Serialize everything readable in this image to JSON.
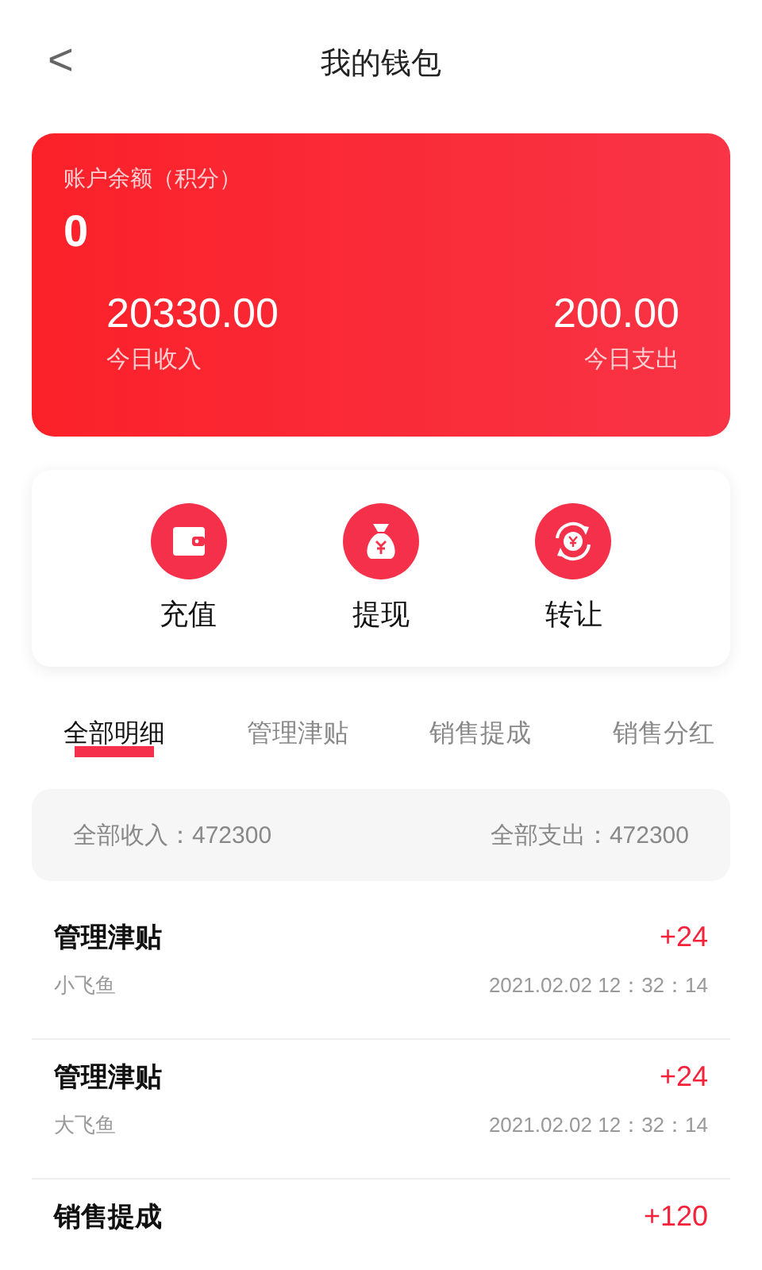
{
  "header": {
    "back": "<",
    "title": "我的钱包"
  },
  "balance_card": {
    "label": "账户余额（积分）",
    "balance": "0",
    "income": {
      "value": "20330.00",
      "label": "今日收入"
    },
    "expense": {
      "value": "200.00",
      "label": "今日支出"
    }
  },
  "actions": [
    {
      "kind": "wallet",
      "label": "充值"
    },
    {
      "kind": "bag",
      "label": "提现"
    },
    {
      "kind": "exchange",
      "label": "转让"
    }
  ],
  "tabs": [
    {
      "label": "全部明细",
      "selected": true
    },
    {
      "label": "管理津贴",
      "selected": false
    },
    {
      "label": "销售提成",
      "selected": false
    },
    {
      "label": "销售分红",
      "selected": false
    }
  ],
  "summary": {
    "income": "全部收入：472300",
    "expense": "全部支出：472300"
  },
  "records": [
    {
      "title": "管理津贴",
      "name": "小飞鱼",
      "amount": "+24",
      "time": "2021.02.02 12：32：14"
    },
    {
      "title": "管理津贴",
      "name": "大飞鱼",
      "amount": "+24",
      "time": "2021.02.02 12：32：14"
    },
    {
      "title": "销售提成",
      "amount": "+120"
    }
  ]
}
